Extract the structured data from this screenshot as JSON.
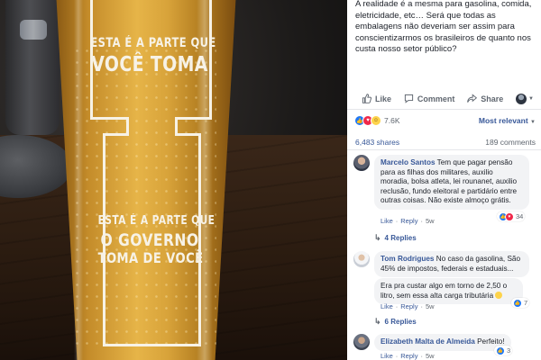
{
  "photo": {
    "glass_text_top_line1": "ESTA É A PARTE QUE",
    "glass_text_top_line2": "VOCÊ TOMA",
    "glass_text_bottom_line1": "ESTA É A PARTE QUE",
    "glass_text_bottom_line2": "O GOVERNO",
    "glass_text_bottom_line3": "TOMA DE VOCÊ"
  },
  "post": {
    "text": "A realidade é a mesma para gasolina, comida, eletricidade, etc… Será que todas as embalagens não deveriam ser assim para conscientizarmos os brasileiros de quanto nos custa nosso setor público?",
    "actions": {
      "like": "Like",
      "comment": "Comment",
      "share": "Share"
    },
    "reaction_count": "7.6K",
    "sort_label": "Most relevant",
    "shares": "6,483 shares",
    "comments": "189 comments"
  },
  "comments": [
    {
      "author": "Marcelo Santos",
      "text": "Tem que pagar pensão para as filhas dos militares, auxilio moradia, bolsa atleta, lei rounanet, auxilio reclusão, fundo eleitoral e partidário entre outras coisas. Não existe almoço grátis.",
      "like": "Like",
      "reply": "Reply",
      "time": "5w",
      "reactions": "34",
      "replies": "4 Replies"
    },
    {
      "author": "Tom Rodrigues",
      "text": "No caso da gasolina, São 45% de impostos, federais e estaduais...",
      "text2": "Era pra custar algo em torno de 2,50 o litro, sem essa alta carga tributária",
      "like": "Like",
      "reply": "Reply",
      "time": "5w",
      "reactions": "7",
      "replies": "6 Replies"
    },
    {
      "author": "Elizabeth Malta de Almeida",
      "text": "Perfeito!",
      "like": "Like",
      "reply": "Reply",
      "time": "5w",
      "reactions": "3"
    }
  ],
  "colors": {
    "fb_link": "#385898",
    "fb_gray": "#606770",
    "like_blue": "#2078f4",
    "love_red": "#f0284a",
    "haha_yellow": "#fdd34b"
  },
  "icons": [
    "like-thumb-icon",
    "comment-icon",
    "share-icon",
    "reply-arrow-icon"
  ]
}
